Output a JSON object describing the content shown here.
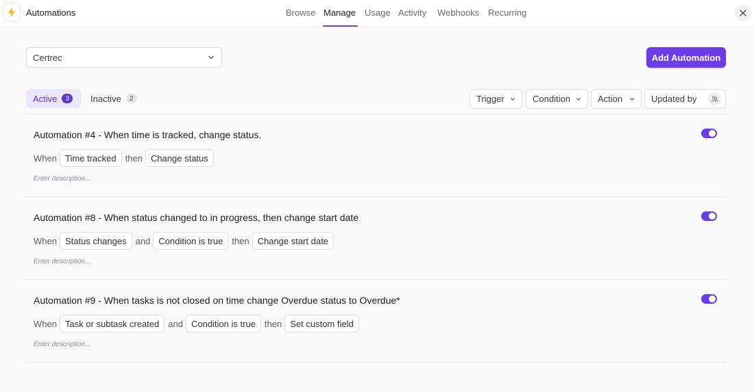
{
  "app": {
    "title": "Automations",
    "icon": "lightning-bolt-icon"
  },
  "nav": {
    "tabs": [
      {
        "label": "Browse"
      },
      {
        "label": "Manage",
        "active": true
      },
      {
        "label": "Usage"
      },
      {
        "label": "Activity"
      },
      {
        "label": "Webhooks"
      },
      {
        "label": "Recurring"
      }
    ]
  },
  "toolbar": {
    "workspace_value": "Certrec",
    "add_label": "Add Automation"
  },
  "status_tabs": {
    "active": {
      "label": "Active",
      "count": "3"
    },
    "inactive": {
      "label": "Inactive",
      "count": "2"
    }
  },
  "filters": {
    "trigger": "Trigger",
    "condition": "Condition",
    "action": "Action",
    "updated_by": "Updated by"
  },
  "automations": [
    {
      "title": "Automation #4 - When time is tracked, change status.",
      "enabled": true,
      "w1": "When",
      "c1": "Time tracked",
      "w2": "then",
      "c2": "Change status",
      "description_placeholder": "Enter description..."
    },
    {
      "title": "Automation #8 - When status changed to in progress, then change start date",
      "enabled": true,
      "w1": "When",
      "c1": "Status changes",
      "w2": "and",
      "c2": "Condition is true",
      "w3": "then",
      "c3": "Change start date",
      "description_placeholder": "Enter description..."
    },
    {
      "title": "Automation #9 - When tasks is not closed on time change Overdue status to Overdue*",
      "enabled": true,
      "w1": "When",
      "c1": "Task or subtask created",
      "w2": "and",
      "c2": "Condition is true",
      "w3": "then",
      "c3": "Set custom field",
      "description_placeholder": "Enter description..."
    }
  ],
  "colors": {
    "accent": "#6a3de8",
    "accent_soft": "#ece7fc"
  }
}
